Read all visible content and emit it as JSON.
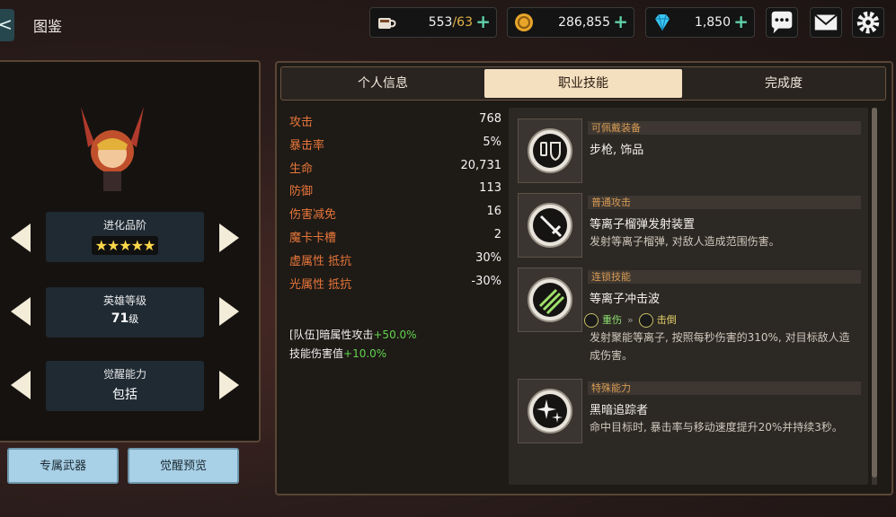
{
  "top_bar": {
    "back_glyph": "<",
    "title": "图鉴",
    "stamina": {
      "current": "553",
      "max": "/63",
      "icon": "coffee-cup-icon"
    },
    "gold": {
      "value": "286,855",
      "icon": "gold-coin-icon"
    },
    "gems": {
      "value": "1,850",
      "icon": "diamond-icon"
    },
    "plus_glyph": "+",
    "buttons": [
      "chat-icon",
      "mail-icon",
      "gear-icon"
    ]
  },
  "hero": {
    "evolution_label": "进化品阶",
    "stars": "★★★★★",
    "level_label": "英雄等级",
    "level_value": "71",
    "level_unit": "级",
    "awaken_label": "觉醒能力",
    "awaken_value": "包括",
    "btn_weapon": "专属武器",
    "btn_awaken_preview": "觉醒预览"
  },
  "tabs": [
    "个人信息",
    "职业技能",
    "完成度"
  ],
  "active_tab": 1,
  "stats": [
    {
      "k": "攻击",
      "v": "768"
    },
    {
      "k": "暴击率",
      "v": "5%"
    },
    {
      "k": "生命",
      "v": "20,731"
    },
    {
      "k": "防御",
      "v": "113"
    },
    {
      "k": "伤害减免",
      "v": "16"
    },
    {
      "k": "魔卡卡槽",
      "v": "2"
    },
    {
      "k": "虚属性 抵抗",
      "v": "30%"
    },
    {
      "k": "光属性 抵抗",
      "v": "-30%"
    }
  ],
  "bonuses": [
    {
      "text": "[队伍]暗属性攻击",
      "value": "+50.0%"
    },
    {
      "text": "技能伤害值",
      "value": "+10.0%"
    }
  ],
  "skills": [
    {
      "category": "可佩戴装备",
      "name": "步枪, 饰品",
      "desc": "",
      "icon": "equipment-icon"
    },
    {
      "category": "普通攻击",
      "name": "等离子榴弹发射装置",
      "desc": "发射等离子榴弹, 对敌人造成范围伤害。",
      "icon": "sword-icon"
    },
    {
      "category": "连锁技能",
      "name": "等离子冲击波",
      "desc": "发射聚能等离子, 按照每秒伤害的310%, 对目标敌人造成伤害。",
      "icon": "slash-icon",
      "chain": {
        "from": "重伤",
        "to": "击倒",
        "arrow": "»"
      }
    },
    {
      "category": "特殊能力",
      "name": "黑暗追踪者",
      "desc": "命中目标时, 暴击率与移动速度提升20%并持续3秒。",
      "icon": "sparkle-icon"
    }
  ],
  "colors": {
    "stat_key": "#e7763a",
    "bonus_green": "#63d44f",
    "category": "#d89c55",
    "tab_active": "#f4dfbf"
  }
}
